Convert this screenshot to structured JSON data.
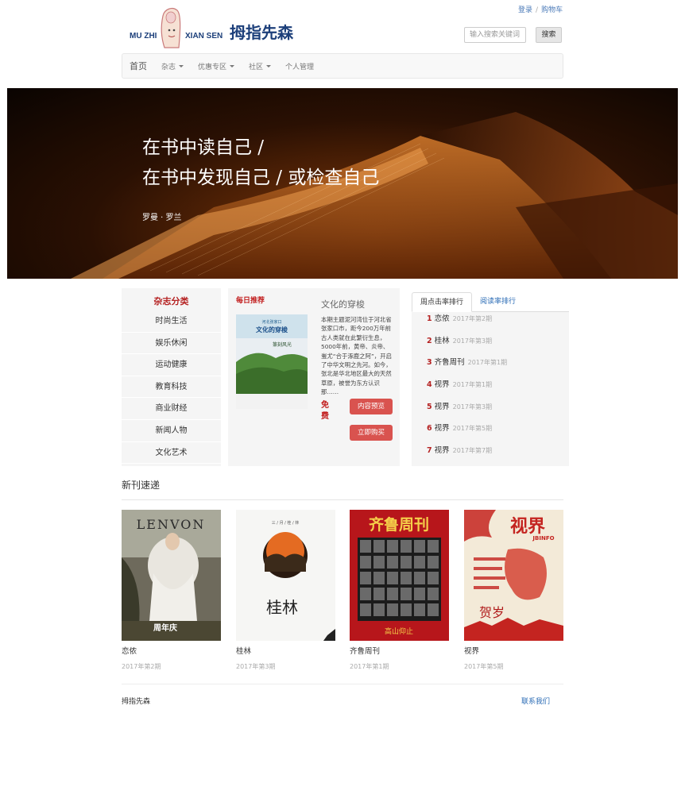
{
  "header": {
    "login": "登录",
    "sep": "/",
    "cart": "购物车",
    "logo_latin_1": "MU ZHI",
    "logo_latin_2": "XIAN SEN",
    "logo_cn": "拇指先森",
    "search_placeholder": "输入搜索关键词",
    "search_button": "搜索"
  },
  "nav": {
    "items": [
      {
        "label": "首页"
      },
      {
        "label": "杂志"
      },
      {
        "label": "优惠专区"
      },
      {
        "label": "社区"
      },
      {
        "label": "个人管理"
      }
    ]
  },
  "hero": {
    "line1": "在书中读自己 /",
    "line2": "在书中发现自己 / 或检查自己",
    "author": "罗曼 · 罗兰"
  },
  "categories": {
    "title": "杂志分类",
    "items": [
      "时尚生活",
      "娱乐休闲",
      "运动健康",
      "教育科技",
      "商业财经",
      "新闻人物",
      "文化艺术"
    ]
  },
  "daily": {
    "label": "每日推荐",
    "title": "文化的穿梭",
    "cover_title": "文化的穿梭",
    "cover_sub": "篆刻风光",
    "cover_top": "河北张家口",
    "desc": "本期主题泥河湾位于河北省张家口市，距今200万年前古人类就在此繁衍生息，5000年前，黄帝、炎帝、蚩尤“合于涿鹿之阿”，开启了中华文明之先河。如今，张北是华北地区最大的天然草原，被誉为东方认识那……",
    "free": "免费",
    "preview_button": "内容预览",
    "buy_button": "立即购买"
  },
  "ranking": {
    "tab_active": "周点击率排行",
    "tab_other": "阅读率排行",
    "rows": [
      {
        "num": "1",
        "name": "恋侬",
        "issue": "2017年第2期"
      },
      {
        "num": "2",
        "name": "桂林",
        "issue": "2017年第3期"
      },
      {
        "num": "3",
        "name": "齐鲁周刊",
        "issue": "2017年第1期"
      },
      {
        "num": "4",
        "name": "视界",
        "issue": "2017年第1期"
      },
      {
        "num": "5",
        "name": "视界",
        "issue": "2017年第3期"
      },
      {
        "num": "6",
        "name": "视界",
        "issue": "2017年第5期"
      },
      {
        "num": "7",
        "name": "视界",
        "issue": "2017年第7期"
      }
    ]
  },
  "new_issues": {
    "title": "新刊速递",
    "items": [
      {
        "name": "恋侬",
        "issue": "2017年第2期",
        "cover_text": "LENVON",
        "cover_note": "周年庆"
      },
      {
        "name": "桂林",
        "issue": "2017年第3期",
        "cover_text": "桂林",
        "cover_top": "三 / 月 / 桂 / 林"
      },
      {
        "name": "齐鲁周刊",
        "issue": "2017年第1期",
        "cover_text": "齐鲁周刊",
        "cover_note": "高山仰止"
      },
      {
        "name": "视界",
        "issue": "2017年第5期",
        "cover_text": "视界",
        "cover_sub": "JBINFO",
        "cover_note": "贺岁"
      }
    ]
  },
  "footer": {
    "left": "拇指先森",
    "right": "联系我们"
  },
  "colors": {
    "accent_red": "#c21e1e",
    "button_red": "#d9534f",
    "link_blue": "#2a6bb5",
    "logo_blue": "#1c3f7a"
  }
}
